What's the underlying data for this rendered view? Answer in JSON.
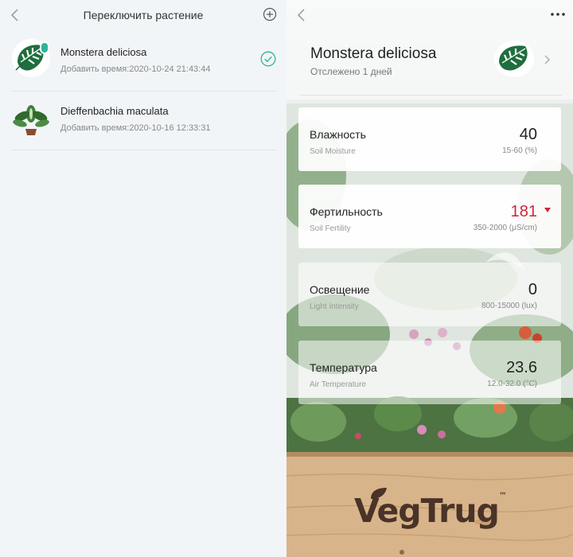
{
  "left": {
    "title": "Переключить растение",
    "plants": [
      {
        "name": "Monstera deliciosa",
        "time": "Добавить время:2020-10-24 21:43:44",
        "selected": true
      },
      {
        "name": "Dieffenbachia maculata",
        "time": "Добавить время:2020-10-16 12:33:31",
        "selected": false
      }
    ]
  },
  "right": {
    "plant_name": "Monstera deliciosa",
    "tracked": "Отслежено 1 дней",
    "metrics": [
      {
        "title": "Влажность",
        "subtitle": "Soil Moisture",
        "value": "40",
        "range": "15-60 (%)",
        "status": "normal"
      },
      {
        "title": "Фертильность",
        "subtitle": "Soil Fertility",
        "value": "181",
        "range": "350-2000 (μS/cm)",
        "status": "low"
      },
      {
        "title": "Освещение",
        "subtitle": "Light Intensity",
        "value": "0",
        "range": "800-15000 (lux)",
        "status": "normal"
      },
      {
        "title": "Температура",
        "subtitle": "Air Temperature",
        "value": "23.6",
        "range": "12.0-32.0 (°C)",
        "status": "normal"
      }
    ],
    "logo": "VegTrug",
    "logo_mark": "™"
  },
  "colors": {
    "accent": "#2fb39a",
    "alert": "#d0253a",
    "text": "#222222",
    "muted": "#888888"
  },
  "icons": {
    "back": "chevron-left-icon",
    "add": "plus-circle-icon",
    "check": "check-circle-icon",
    "more": "more-dots-icon",
    "forward": "chevron-right-icon",
    "down": "triangle-down-icon"
  }
}
